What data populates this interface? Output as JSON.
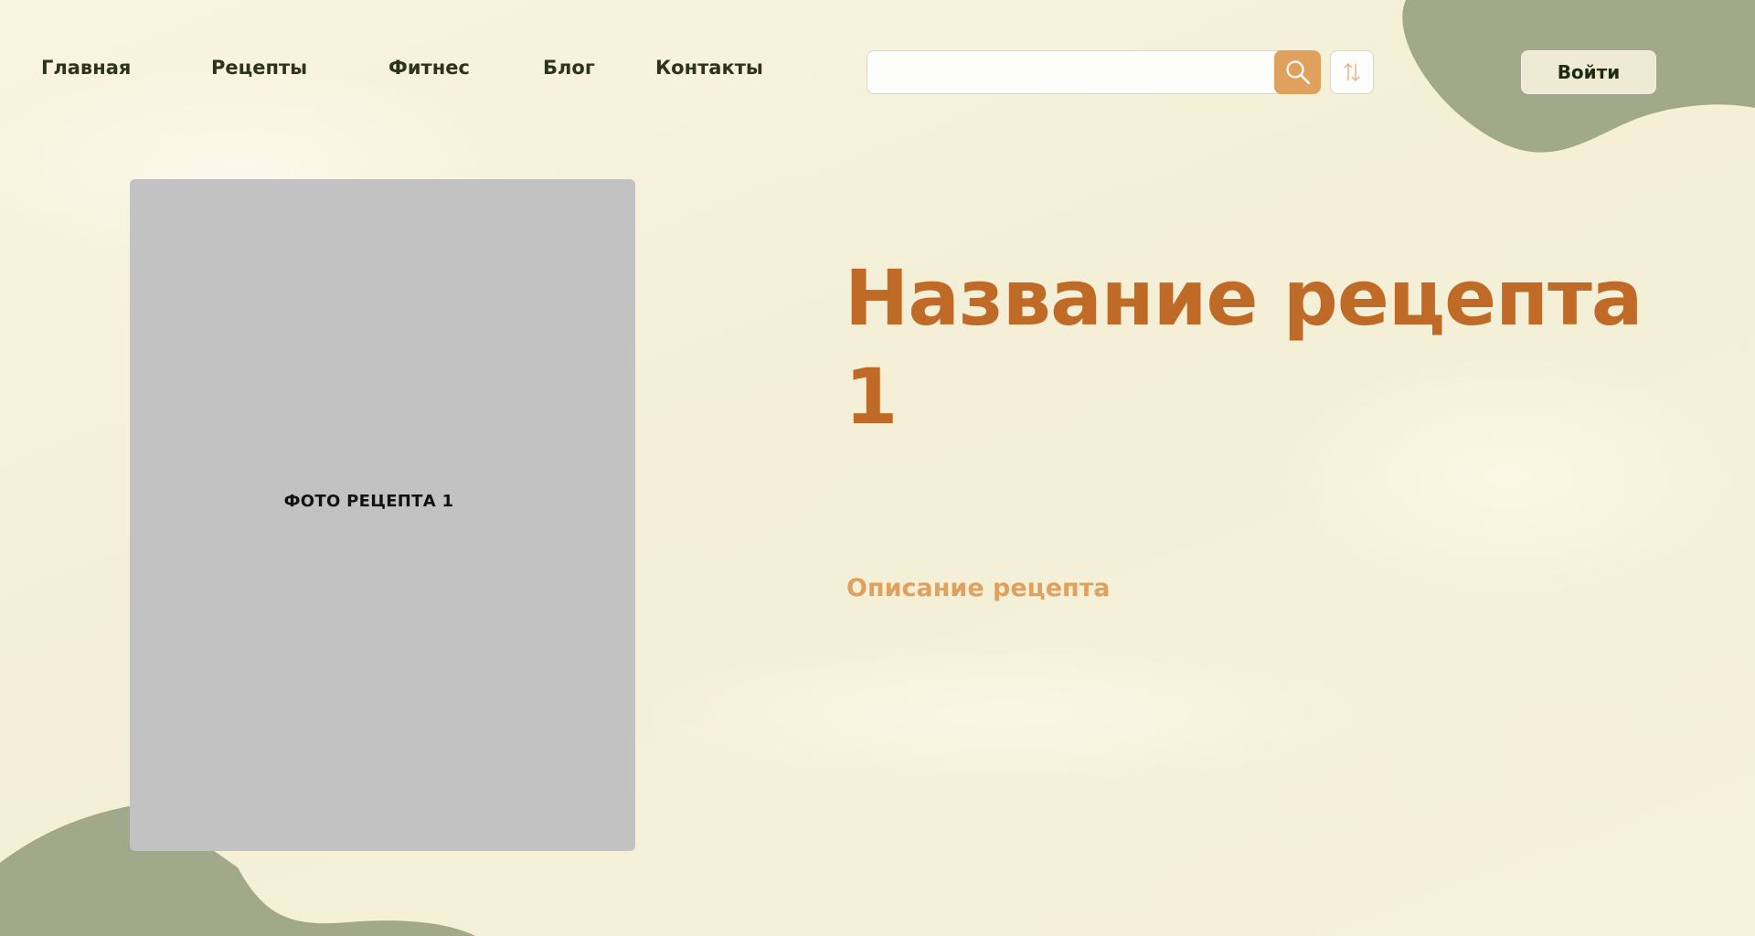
{
  "nav": {
    "items": [
      {
        "label": "Главная"
      },
      {
        "label": "Рецепты"
      },
      {
        "label": "Фитнес"
      },
      {
        "label": "Блог"
      },
      {
        "label": "Контакты"
      }
    ]
  },
  "search": {
    "placeholder": "",
    "value": "",
    "search_icon": "magnifier-icon",
    "sort_icon": "sort-arrows-icon"
  },
  "auth": {
    "login_label": "Войти"
  },
  "recipe": {
    "photo_label": "ФОТО РЕЦЕПТА 1",
    "title": "Название рецепта 1",
    "description": "Описание рецепта"
  },
  "colors": {
    "background": "#f6f1dc",
    "blob": "#a2a88a",
    "accent": "#e0a15e",
    "title": "#bf6a26",
    "nav_text": "#2c341e",
    "photo_placeholder": "#c2c2c2"
  }
}
